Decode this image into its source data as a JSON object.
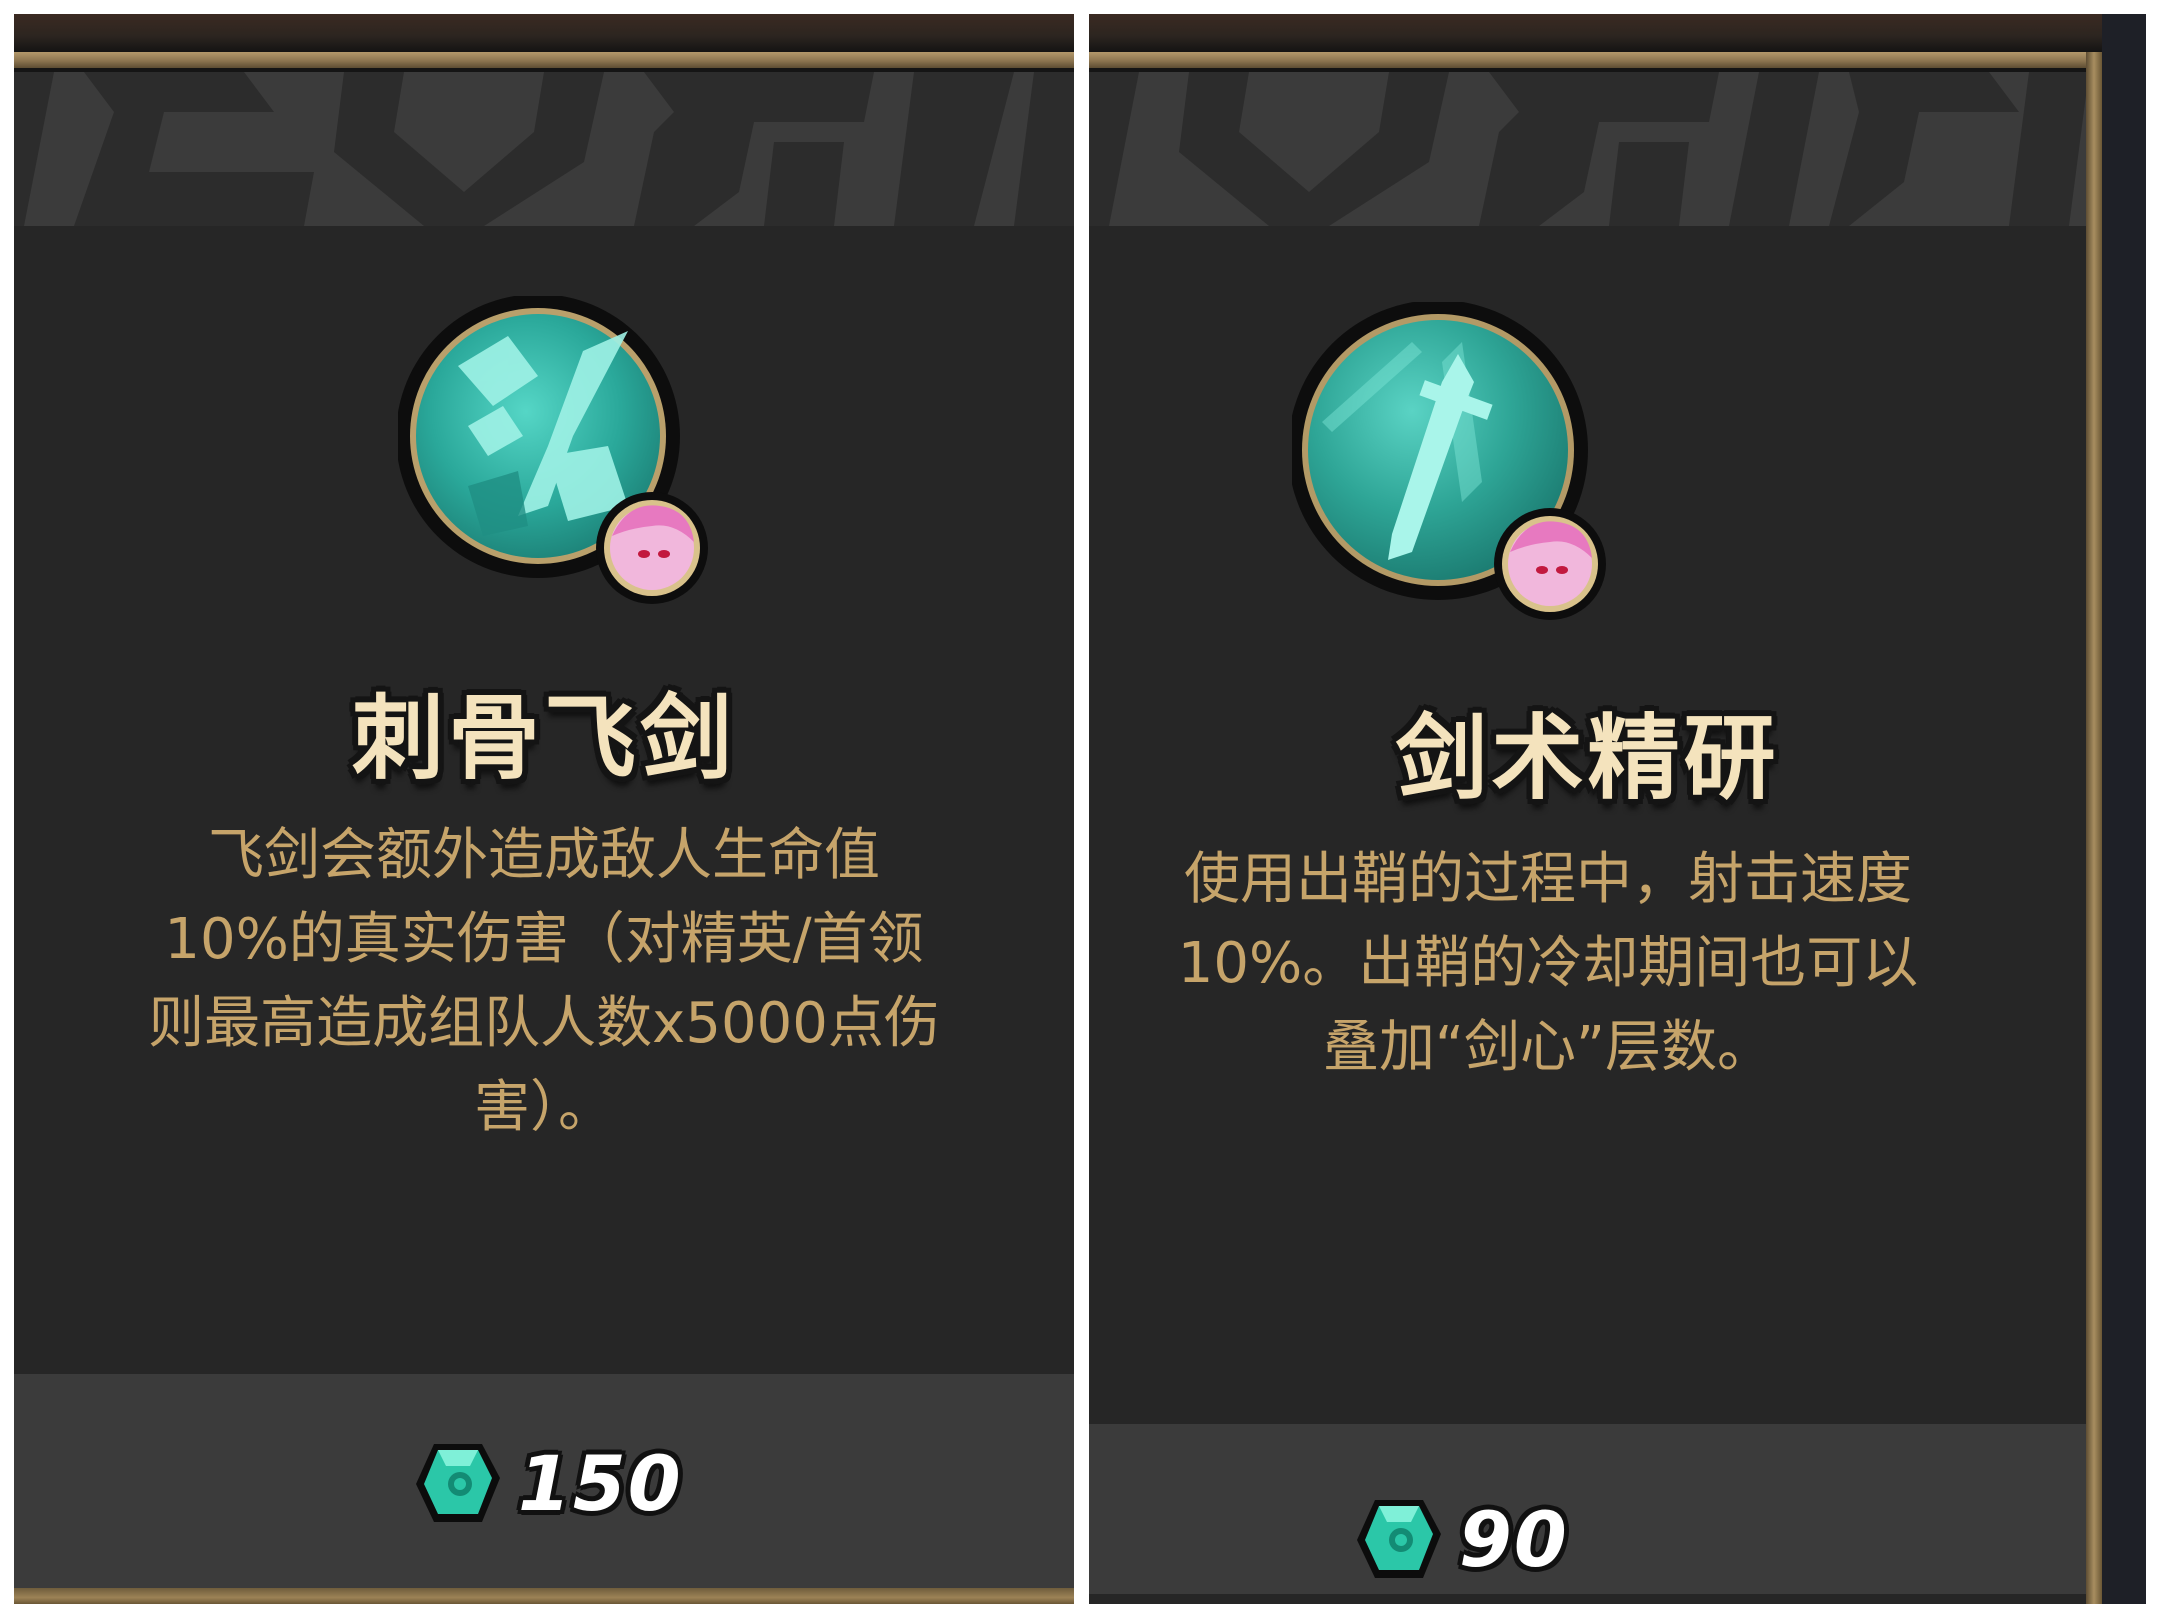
{
  "cards": [
    {
      "title": "刺骨飞剑",
      "description_lines": [
        "飞剑会额外造成敌人生命值",
        "10%的真实伤害（对精英/首领",
        "则最高造成组队人数x5000点伤",
        "害）。"
      ],
      "cost": "150",
      "icon": "flying-sword-skill-icon",
      "badge_icon": "pink-hair-hero-portrait-icon",
      "currency_icon": "teal-gem-icon"
    },
    {
      "title": "剑术精研",
      "description_lines": [
        "使用出鞘的过程中，射击速度",
        "10%。出鞘的冷却期间也可以",
        "叠加“剑心”层数。"
      ],
      "cost": "90",
      "icon": "sword-mastery-skill-icon",
      "badge_icon": "pink-hair-hero-portrait-icon",
      "currency_icon": "teal-gem-icon"
    }
  ],
  "colors": {
    "title": "#f4e3bd",
    "description": "#c6a46a",
    "icon_teal": "#2fb3a4",
    "gold_frame": "#a88e60"
  }
}
